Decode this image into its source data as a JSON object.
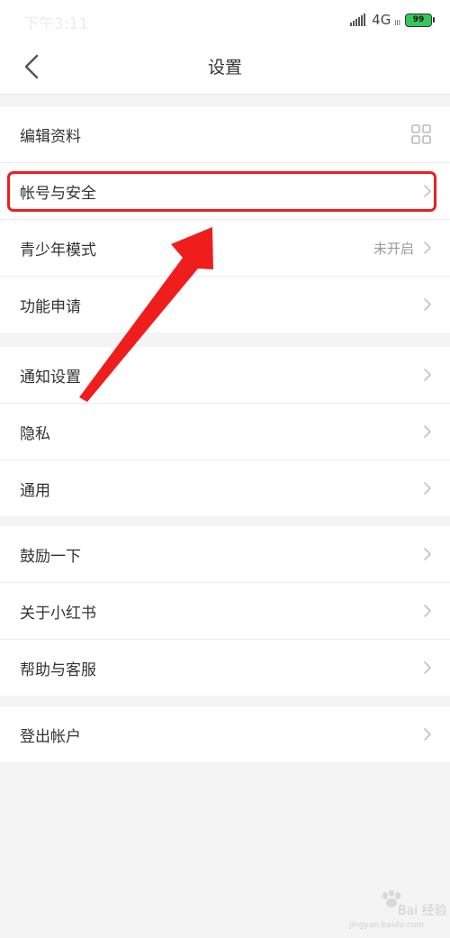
{
  "status": {
    "time": "下午3:11",
    "network": "4G",
    "network_sub": "ill",
    "battery": "99"
  },
  "header": {
    "title": "设置"
  },
  "groups": [
    {
      "items": [
        {
          "label": "编辑资料",
          "icon": "qr-code-icon"
        },
        {
          "label": "帐号与安全",
          "icon": "chevron-right-icon"
        },
        {
          "label": "青少年模式",
          "value": "未开启",
          "icon": "chevron-right-icon"
        },
        {
          "label": "功能申请",
          "icon": "chevron-right-icon"
        }
      ]
    },
    {
      "items": [
        {
          "label": "通知设置",
          "icon": "chevron-right-icon"
        },
        {
          "label": "隐私",
          "icon": "chevron-right-icon"
        },
        {
          "label": "通用",
          "icon": "chevron-right-icon"
        }
      ]
    },
    {
      "items": [
        {
          "label": "鼓励一下",
          "icon": "chevron-right-icon"
        },
        {
          "label": "关于小红书",
          "icon": "chevron-right-icon"
        },
        {
          "label": "帮助与客服",
          "icon": "chevron-right-icon"
        }
      ]
    },
    {
      "items": [
        {
          "label": "登出帐户",
          "icon": "chevron-right-icon"
        }
      ]
    }
  ],
  "annotation": {
    "color": "#f01d1d"
  },
  "watermark": {
    "text": "Bai 经验",
    "sub": "jingyan.baidu.com"
  }
}
